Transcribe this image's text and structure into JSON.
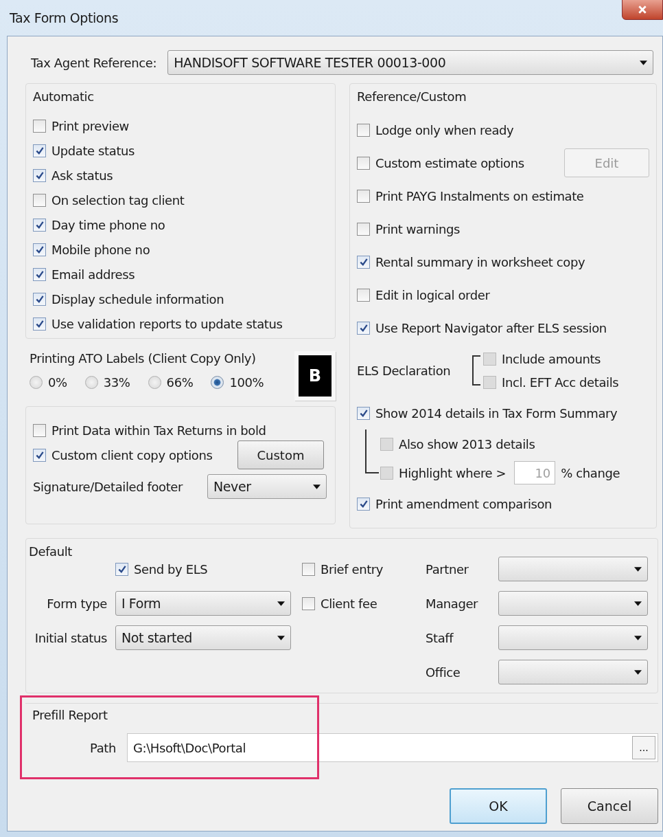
{
  "window": {
    "title": "Tax Form Options"
  },
  "tax_agent_reference": {
    "label": "Tax Agent Reference:",
    "value": "HANDISOFT SOFTWARE TESTER 00013-000"
  },
  "automatic": {
    "title": "Automatic",
    "options": [
      {
        "label": "Print preview",
        "checked": false
      },
      {
        "label": "Update status",
        "checked": true
      },
      {
        "label": "Ask status",
        "checked": true
      },
      {
        "label": "On selection tag client",
        "checked": false
      },
      {
        "label": "Day time phone no",
        "checked": true
      },
      {
        "label": "Mobile phone no",
        "checked": true
      },
      {
        "label": "Email address",
        "checked": true
      },
      {
        "label": "Display schedule information",
        "checked": true
      },
      {
        "label": "Use validation reports to update status",
        "checked": true
      }
    ]
  },
  "ato_labels": {
    "title": "Printing ATO Labels (Client Copy Only)",
    "options": [
      {
        "label": "0%",
        "selected": false
      },
      {
        "label": "33%",
        "selected": false
      },
      {
        "label": "66%",
        "selected": false
      },
      {
        "label": "100%",
        "selected": true
      }
    ],
    "bold_button": "B"
  },
  "print_options": {
    "bold_data": {
      "label": "Print Data within Tax Returns in bold",
      "checked": false
    },
    "custom_copy": {
      "label": "Custom client copy options",
      "checked": true,
      "button": "Custom"
    },
    "footer": {
      "label": "Signature/Detailed footer",
      "value": "Never"
    }
  },
  "reference_custom": {
    "title": "Reference/Custom",
    "options": [
      {
        "label": "Lodge only when ready",
        "checked": false
      },
      {
        "label": "Custom estimate options",
        "checked": false,
        "button": {
          "label": "Edit",
          "disabled": true
        }
      },
      {
        "label": "Print PAYG Instalments on estimate",
        "checked": false
      },
      {
        "label": "Print warnings",
        "checked": false
      },
      {
        "label": "Rental summary in worksheet copy",
        "checked": true
      },
      {
        "label": "Edit in logical order",
        "checked": false
      },
      {
        "label": "Use Report Navigator after ELS session",
        "checked": true
      }
    ],
    "els_declaration": {
      "label": "ELS Declaration",
      "options": [
        {
          "label": "Include amounts",
          "checked": false,
          "disabled": true
        },
        {
          "label": "Incl. EFT Acc details",
          "checked": false,
          "disabled": true
        }
      ]
    },
    "summary": {
      "label": "Show 2014 details in Tax Form Summary",
      "checked": true,
      "children": [
        {
          "label": "Also show 2013 details",
          "checked": false,
          "disabled": true
        },
        {
          "label": "Highlight where >",
          "checked": false,
          "disabled": true,
          "threshold": "10",
          "suffix": "% change"
        }
      ]
    },
    "amendment": {
      "label": "Print amendment comparison",
      "checked": true
    }
  },
  "default": {
    "title": "Default",
    "send_by_els": {
      "label": "Send by ELS",
      "checked": true
    },
    "brief_entry": {
      "label": "Brief entry",
      "checked": false
    },
    "client_fee": {
      "label": "Client fee",
      "checked": false
    },
    "form_type": {
      "label": "Form type",
      "value": "I Form"
    },
    "initial_status": {
      "label": "Initial status",
      "value": "Not started"
    },
    "staff": [
      {
        "label": "Partner"
      },
      {
        "label": "Manager"
      },
      {
        "label": "Staff"
      },
      {
        "label": "Office"
      }
    ]
  },
  "prefill": {
    "title": "Prefill Report",
    "highlighted": true,
    "path_label": "Path",
    "path": "G:\\Hsoft\\Doc\\Portal",
    "browse": "..."
  },
  "buttons": [
    {
      "label": "OK",
      "default": true
    },
    {
      "label": "Cancel",
      "default": false
    }
  ]
}
